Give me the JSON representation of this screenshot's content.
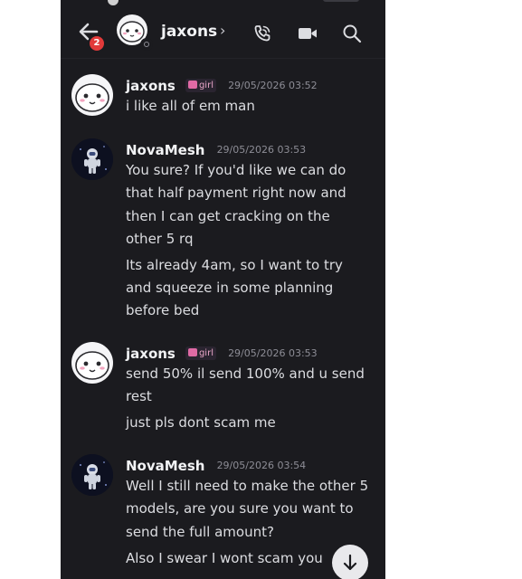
{
  "header": {
    "title": "jaxons",
    "unread_count": "2"
  },
  "icons": {
    "back": "arrow-left-icon",
    "call": "phone-call-icon",
    "video": "video-camera-icon",
    "search": "search-icon",
    "scroll": "arrow-down-icon"
  },
  "colors": {
    "background": "#1b1b1f",
    "badge": "#e23a3a",
    "tag_pink": "#e06aa5"
  },
  "messages": [
    {
      "author": "jaxons",
      "tag": "girl",
      "time": "29/05/2026 03:52",
      "lines": [
        "i like all of em man"
      ]
    },
    {
      "author": "NovaMesh",
      "time": "29/05/2026 03:53",
      "lines": [
        "You sure? If you'd like we can do",
        "that half payment right now and",
        "then I can get cracking on the",
        "other 5 rq",
        "Its already 4am, so I want to try",
        "and squeeze in some planning",
        "before bed"
      ]
    },
    {
      "author": "jaxons",
      "tag": "girl",
      "time": "29/05/2026 03:53",
      "lines": [
        "send 50% il send 100% and u send",
        "rest",
        "just pls dont scam me"
      ]
    },
    {
      "author": "NovaMesh",
      "time": "29/05/2026 03:54",
      "lines": [
        "Well I still need to make the other 5",
        "models, are you sure you want to",
        "send the full amount?",
        "Also I swear I wont scam you"
      ]
    }
  ]
}
